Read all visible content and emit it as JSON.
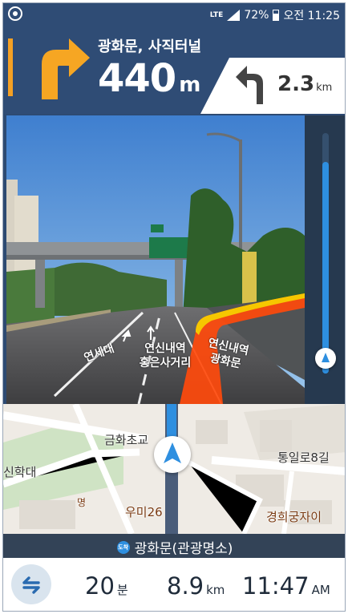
{
  "status_bar": {
    "network": "LTE",
    "battery": "72%",
    "time": "오전 11:25"
  },
  "turn": {
    "street": "광화문, 사직터널",
    "distance": "440",
    "distance_unit": "m",
    "direction": "right"
  },
  "next_turn": {
    "direction": "left",
    "distance": "2.3",
    "distance_unit": "km"
  },
  "camera": {
    "lane_labels": [
      "연세대",
      "연신내역\n홍은사거리",
      "연신내역\n광화문"
    ],
    "route_color": "#ff4a0c"
  },
  "route_progress": 0.88,
  "map": {
    "labels": [
      "금화초교",
      "통일로8길",
      "신학대",
      "우미26",
      "경희궁자이",
      "명"
    ]
  },
  "destination": {
    "badge": "도착",
    "name": "광화문(관광명소)"
  },
  "bottom": {
    "duration": "20",
    "duration_unit": "분",
    "distance": "8.9",
    "distance_unit": "km",
    "eta": "11:47",
    "eta_suffix": "AM"
  },
  "colors": {
    "header": "#2f4c75",
    "accent": "#f4a024",
    "route_blue": "#2e8fe0"
  }
}
